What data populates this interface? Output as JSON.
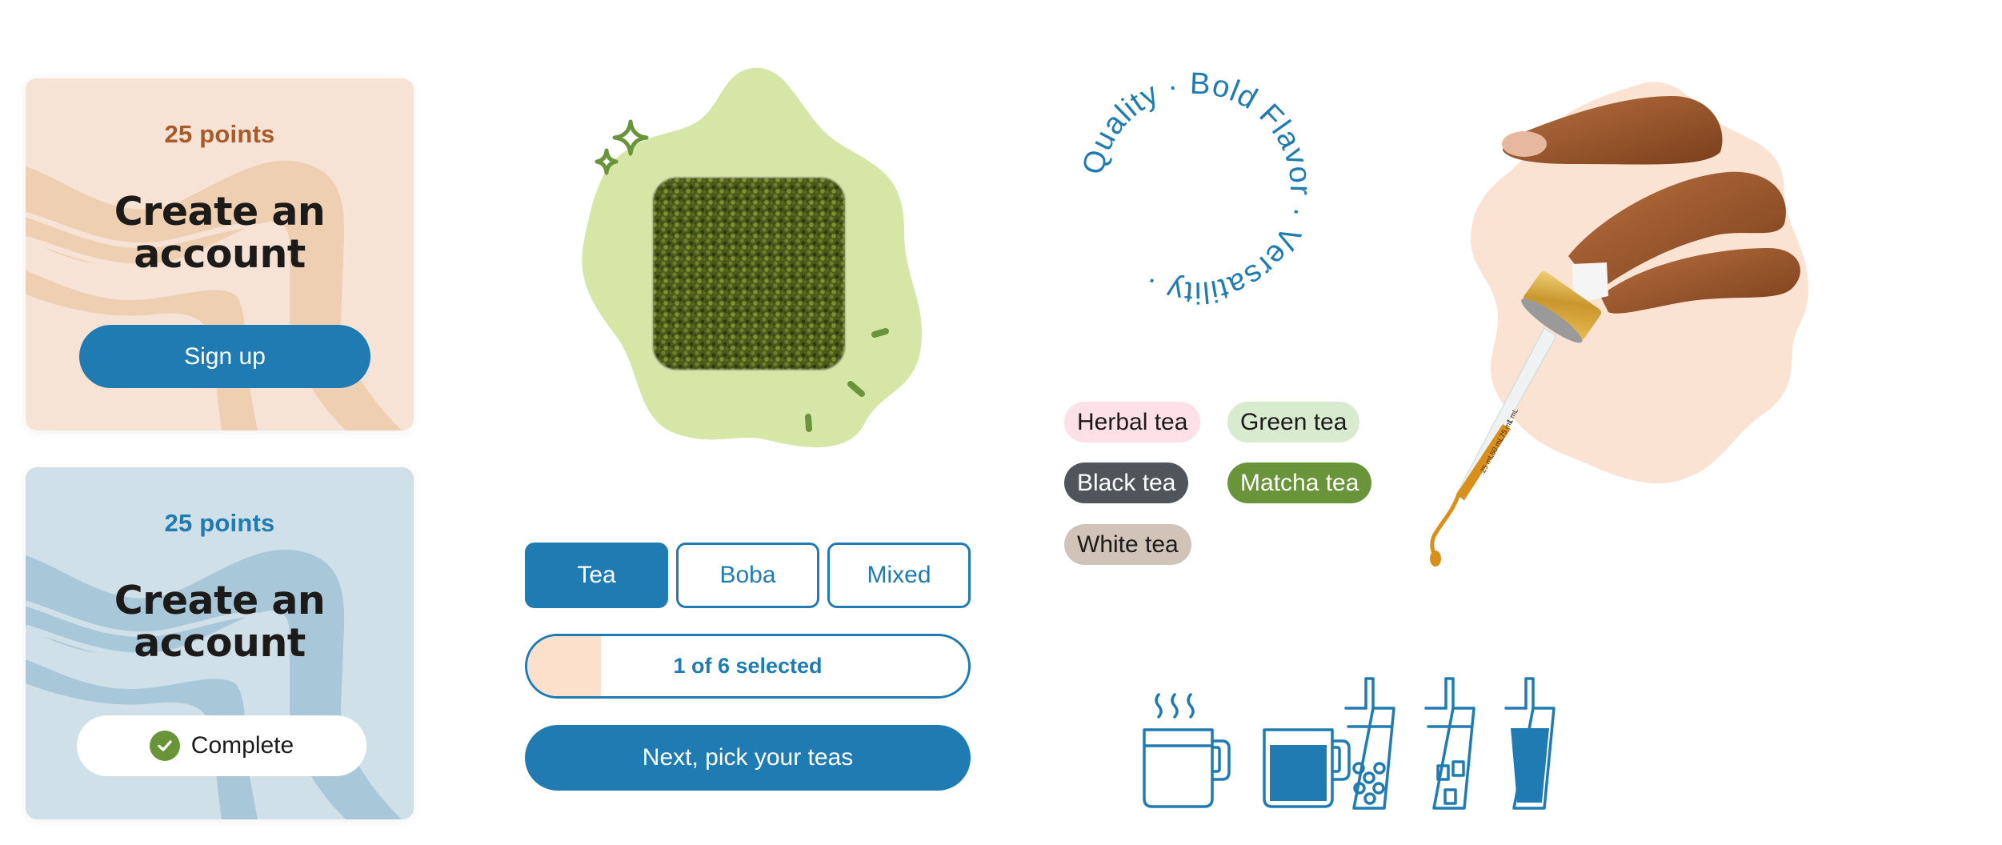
{
  "colors": {
    "brand_blue": "#1f7bb2",
    "peach_card": "#f6e3d5",
    "peach_wave": "#efcfb2",
    "blue_card": "#d0e0e8",
    "blue_wave": "#a8c8da",
    "green_blob": "#d5e6a6",
    "leaf_green": "#6a943a",
    "progress_fill": "#fde0cb"
  },
  "cards": [
    {
      "points": "25 points",
      "title_line1": "Create an",
      "title_line2": "account",
      "action_label": "Sign up",
      "state": "incomplete"
    },
    {
      "points": "25 points",
      "title_line1": "Create an",
      "title_line2": "account",
      "action_label": "Complete",
      "state": "complete"
    }
  ],
  "segmented": {
    "options": [
      "Tea",
      "Boba",
      "Mixed"
    ],
    "selected": "Tea"
  },
  "progress": {
    "label": "1 of 6 selected",
    "selected": 1,
    "total": 6
  },
  "next_button": {
    "label": "Next, pick your teas"
  },
  "badge_ring": {
    "text": "Quality · Bold Flavor · Versatility · "
  },
  "tea_tags": [
    {
      "label": "Herbal tea",
      "bg": "#fde0e8",
      "fg": "#1d1a1a"
    },
    {
      "label": "Green tea",
      "bg": "#d9ebcf",
      "fg": "#1d1a1a"
    },
    {
      "label": "Black tea",
      "bg": "#50555b",
      "fg": "#ffffff"
    },
    {
      "label": "Matcha tea",
      "bg": "#6a943a",
      "fg": "#ffffff"
    },
    {
      "label": "White tea",
      "bg": "#d0c4b9",
      "fg": "#1d1a1a"
    }
  ],
  "dropper": {
    "markings": [
      ".25 mL",
      ".50 mL",
      ".75 mL",
      "1 mL"
    ]
  },
  "drink_icons": [
    {
      "name": "hot-tea-mug-icon"
    },
    {
      "name": "filled-mug-icon"
    },
    {
      "name": "boba-cup-icon"
    },
    {
      "name": "iced-cup-icon"
    },
    {
      "name": "filled-cup-icon"
    }
  ]
}
